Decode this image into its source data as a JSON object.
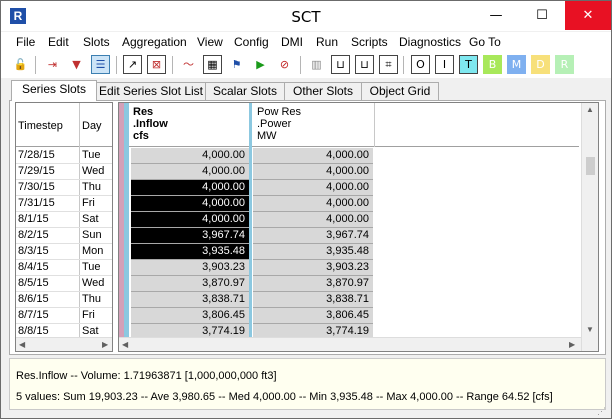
{
  "window": {
    "title": "SCT",
    "minimize": "—",
    "maximize": "☐",
    "close": "✕"
  },
  "menu": [
    "File",
    "Edit",
    "Slots",
    "Aggregation",
    "View",
    "Config",
    "DMI",
    "Run",
    "Scripts",
    "Diagnostics",
    "Go To"
  ],
  "toolbar_letters": [
    "O",
    "I",
    "T",
    "B",
    "M",
    "D",
    "R"
  ],
  "toolbar_letter_colors": [
    "#ffffff",
    "#ffffff",
    "#7fe8f0",
    "#a8e85a",
    "#7fb0f0",
    "#f7e07a",
    "#b6f0b6"
  ],
  "tabs": [
    "Series Slots",
    "Edit Series Slot List",
    "Scalar Slots",
    "Other Slots",
    "Object Grid"
  ],
  "date_headers": {
    "timestep": "Timestep",
    "day": "Day"
  },
  "columns": [
    {
      "line1": "Res",
      "line2": ".Inflow",
      "line3": "cfs"
    },
    {
      "line1": "Pow Res",
      "line2": ".Power",
      "line3": "MW"
    }
  ],
  "rows": [
    {
      "date": "7/28/15",
      "day": "Tue",
      "inflow": "4,000.00",
      "power": "4,000.00",
      "selected": false
    },
    {
      "date": "7/29/15",
      "day": "Wed",
      "inflow": "4,000.00",
      "power": "4,000.00",
      "selected": false
    },
    {
      "date": "7/30/15",
      "day": "Thu",
      "inflow": "4,000.00",
      "power": "4,000.00",
      "selected": true
    },
    {
      "date": "7/31/15",
      "day": "Fri",
      "inflow": "4,000.00",
      "power": "4,000.00",
      "selected": true
    },
    {
      "date": "8/1/15",
      "day": "Sat",
      "inflow": "4,000.00",
      "power": "4,000.00",
      "selected": true
    },
    {
      "date": "8/2/15",
      "day": "Sun",
      "inflow": "3,967.74",
      "power": "3,967.74",
      "selected": true
    },
    {
      "date": "8/3/15",
      "day": "Mon",
      "inflow": "3,935.48",
      "power": "3,935.48",
      "selected": true
    },
    {
      "date": "8/4/15",
      "day": "Tue",
      "inflow": "3,903.23",
      "power": "3,903.23",
      "selected": false
    },
    {
      "date": "8/5/15",
      "day": "Wed",
      "inflow": "3,870.97",
      "power": "3,870.97",
      "selected": false
    },
    {
      "date": "8/6/15",
      "day": "Thu",
      "inflow": "3,838.71",
      "power": "3,838.71",
      "selected": false
    },
    {
      "date": "8/7/15",
      "day": "Fri",
      "inflow": "3,806.45",
      "power": "3,806.45",
      "selected": false
    },
    {
      "date": "8/8/15",
      "day": "Sat",
      "inflow": "3,774.19",
      "power": "3,774.19",
      "selected": false
    }
  ],
  "status": {
    "line1": "Res.Inflow -- Volume: 1.71963871 [1,000,000,000 ft3]",
    "line2": "5 values:  Sum 19,903.23 -- Ave 3,980.65 -- Med 4,000.00 -- Min 3,935.48 -- Max 4,000.00 -- Range 64.52 [cfs]"
  },
  "colors": {
    "selection": "#000000",
    "cell": "#d8d8d8",
    "stripe_pink": "#d4a0b8",
    "stripe_blue": "#8cc8e0",
    "status_bg": "#fffff0"
  }
}
